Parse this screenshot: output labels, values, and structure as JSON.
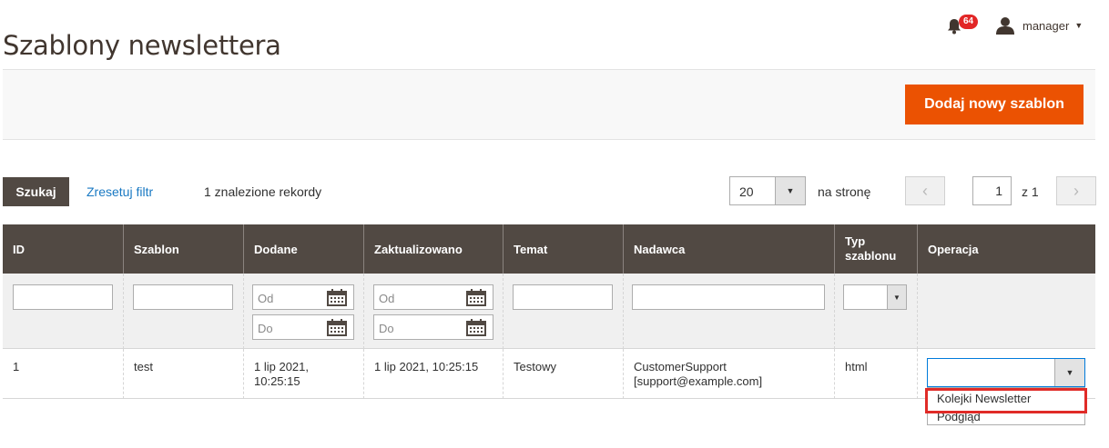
{
  "page": {
    "title": "Szablony newslettera"
  },
  "header": {
    "notifications_count": "64",
    "user_name": "manager"
  },
  "actions": {
    "add_button_label": "Dodaj nowy szablon"
  },
  "toolbar": {
    "search_label": "Szukaj",
    "reset_label": "Zresetuj filtr",
    "records_text": "1 znalezione rekordy",
    "per_page_value": "20",
    "per_page_label": "na stronę",
    "page_value": "1",
    "page_total": "z 1"
  },
  "grid": {
    "columns": [
      "ID",
      "Szablon",
      "Dodane",
      "Zaktualizowano",
      "Temat",
      "Nadawca",
      "Typ szablonu",
      "Operacja"
    ],
    "filters": {
      "date_from_placeholder": "Od",
      "date_to_placeholder": "Do"
    },
    "rows": [
      {
        "id": "1",
        "template": "test",
        "added": "1 lip 2021, 10:25:15",
        "updated": "1 lip 2021, 10:25:15",
        "subject": "Testowy",
        "sender_name": "CustomerSupport",
        "sender_email": "[support@example.com]",
        "type": "html"
      }
    ],
    "operation_options": [
      "Kolejki Newsletter",
      "Podgląd"
    ]
  },
  "colors": {
    "accent": "#eb5202",
    "header_bg": "#514943",
    "highlight": "#e02b27",
    "link": "#1979c3"
  }
}
